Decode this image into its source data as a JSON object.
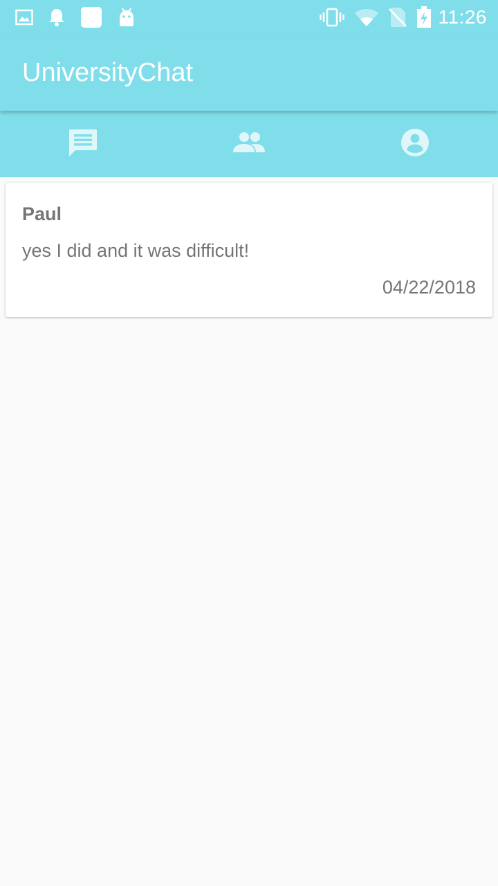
{
  "status_bar": {
    "time": "11:26",
    "left_icons": [
      "image-icon",
      "bell-icon",
      "square-app-icon",
      "android-icon"
    ],
    "right_icons": [
      "vibrate-icon",
      "wifi-icon",
      "no-sim-icon",
      "battery-charging-icon"
    ]
  },
  "app": {
    "title": "UniversityChat",
    "accent_color": "#80deea"
  },
  "tabs": [
    {
      "icon": "chat-icon",
      "selected": true
    },
    {
      "icon": "people-icon",
      "selected": false
    },
    {
      "icon": "account-circle-icon",
      "selected": false
    }
  ],
  "messages": [
    {
      "name": "Paul",
      "text": "yes I did and it was difficult!",
      "date": "04/22/2018"
    }
  ]
}
